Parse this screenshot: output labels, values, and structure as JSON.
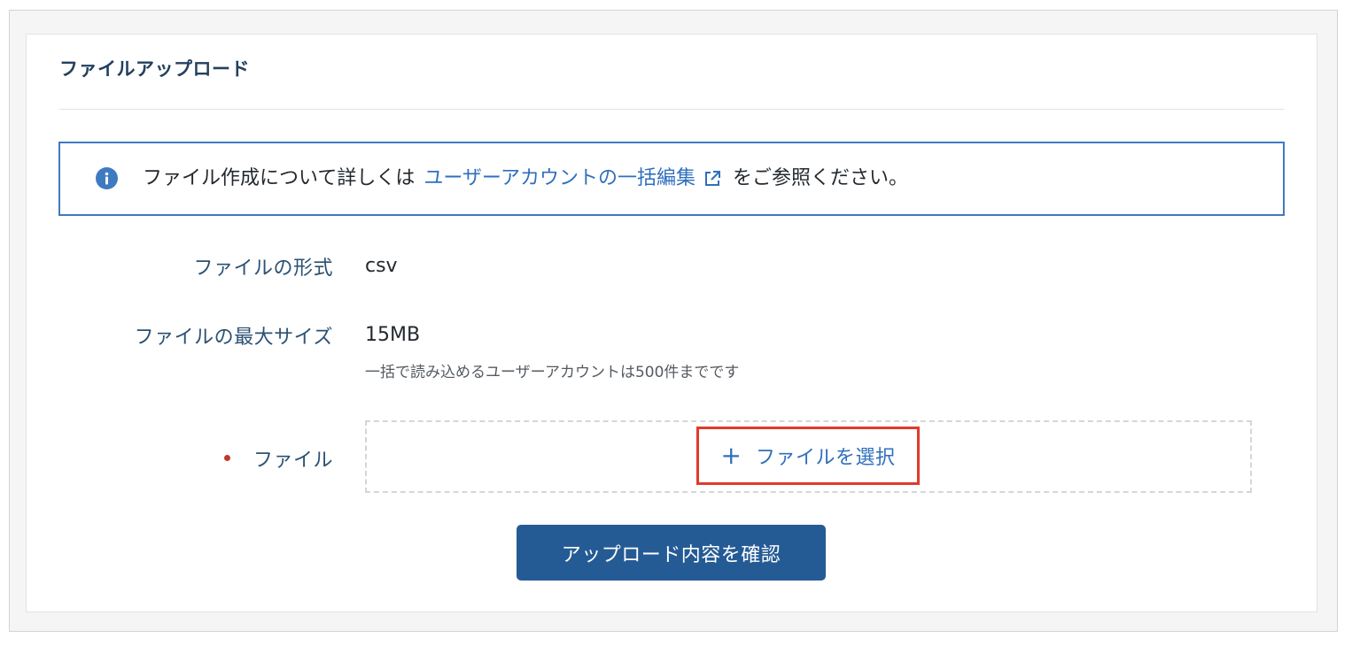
{
  "title": "ファイルアップロード",
  "info": {
    "icon": "info-icon",
    "text_before": "ファイル作成について詳しくは",
    "link_text": "ユーザーアカウントの一括編集",
    "link_icon": "external-link-icon",
    "text_after": "をご参照ください。"
  },
  "fields": {
    "format": {
      "label": "ファイルの形式",
      "value": "csv"
    },
    "max_size": {
      "label": "ファイルの最大サイズ",
      "value": "15MB",
      "hint": "一括で読み込めるユーザーアカウントは500件までです"
    },
    "file": {
      "label": "ファイル",
      "required": true,
      "select_label": "ファイルを選択",
      "select_icon": "plus-icon"
    }
  },
  "confirm_button": "アップロード内容を確認",
  "colors": {
    "heading": "#23405f",
    "link": "#2f6fbd",
    "info_border": "#3e7ac2",
    "primary_button": "#255b95",
    "highlight": "#e03b2a",
    "required": "#c0392b"
  }
}
